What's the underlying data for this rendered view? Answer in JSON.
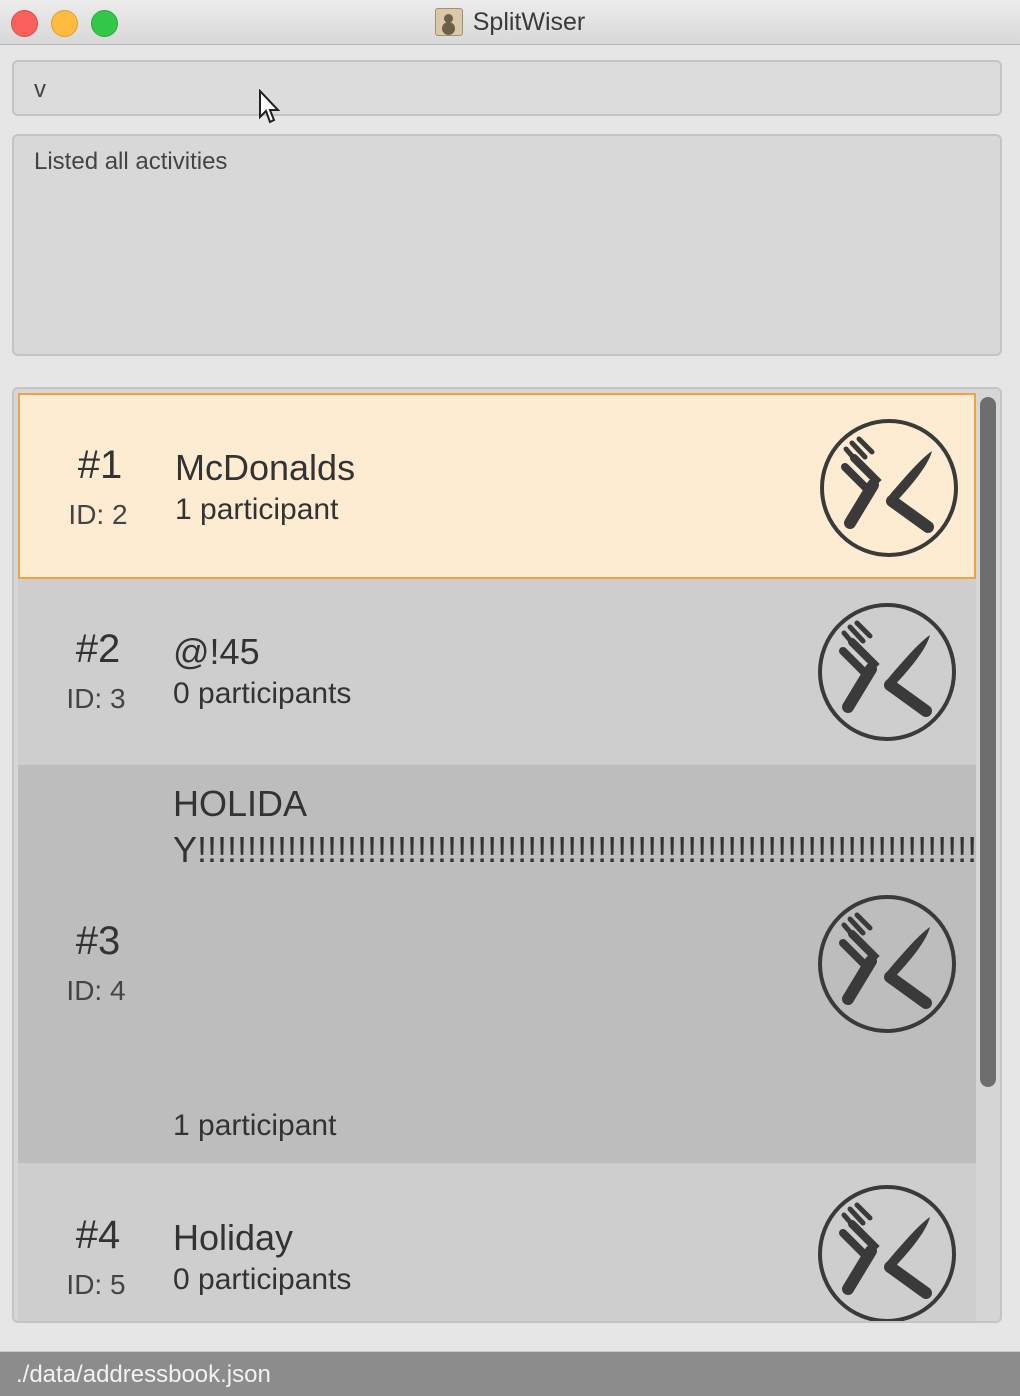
{
  "window": {
    "title": "SplitWiser"
  },
  "command": {
    "value": "v",
    "placeholder": ""
  },
  "result": {
    "text": "Listed all activities"
  },
  "activities": [
    {
      "index": "#1",
      "id": "ID: 2",
      "name": "McDonalds",
      "participants": "1 participant",
      "icon": "fork-knife-icon",
      "selected": true
    },
    {
      "index": "#2",
      "id": "ID: 3",
      "name": "@!45",
      "participants": "0 participants",
      "icon": "fork-knife-icon",
      "selected": false
    },
    {
      "index": "#3",
      "id": "ID: 4",
      "name": "HOLIDAY!!!!!!!!!!!!!!!!!!!!!!!!!!!!!!!!!!!!!!!!!!!!!!!!!!!!!!!!!!!!!!!!!!!!!!!!!!!!!!!!!!!!!!!!!!!!!!!!!!!!!!!!!!!!!!!!!!!!!!!!!!!!!!!!!!!!!!!!!!!!!!!!!!!!!!!!!!!!!!!!!!!!!!!!!!!!!!!!!!!!!!!!!!!!!!!!!!!!!!!!!!!!!!!!!!!!!!!!!!!!!!!!!!!!!!!!!!!!!!!!!!!!!!!!!!!!!!!!!!!!!!!!!!!!!!!!!!!!!!!!!!!!!!!!!!!!!",
      "participants": "1 participant",
      "icon": "fork-knife-icon",
      "selected": false
    },
    {
      "index": "#4",
      "id": "ID: 5",
      "name": "Holiday",
      "participants": "0 participants",
      "icon": "fork-knife-icon",
      "selected": false
    }
  ],
  "status": {
    "path": "./data/addressbook.json"
  },
  "colors": {
    "selected_bg": "#fdecd1",
    "selected_border": "#f3a046",
    "status_bg": "#8c8c8c"
  }
}
